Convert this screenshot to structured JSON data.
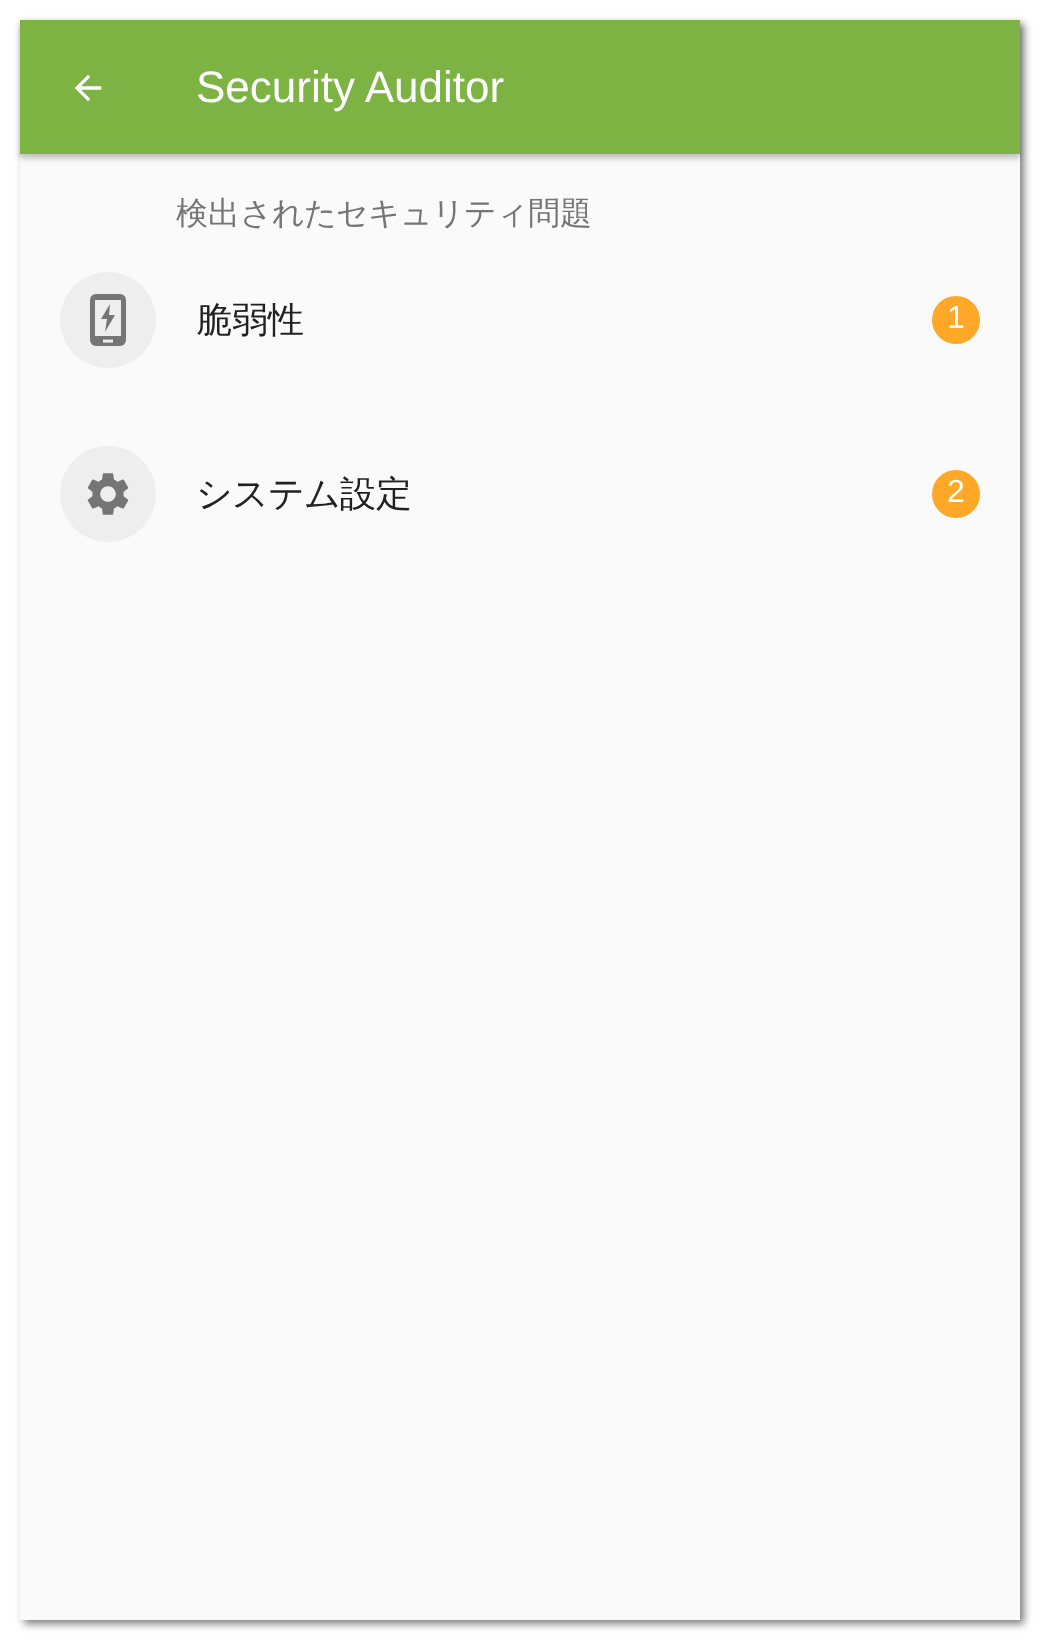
{
  "app_bar": {
    "title": "Security Auditor"
  },
  "section": {
    "header": "検出されたセキュリティ問題"
  },
  "items": [
    {
      "kind": "phone",
      "label": "脆弱性",
      "count": "1"
    },
    {
      "kind": "gear",
      "label": "システム設定",
      "count": "2"
    }
  ]
}
